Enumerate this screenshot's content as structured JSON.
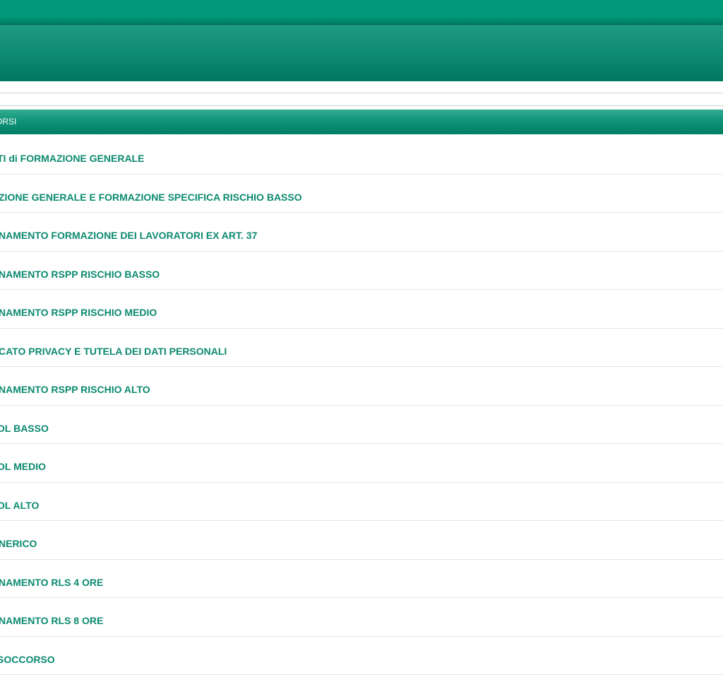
{
  "header": {
    "section_label": "ORSI"
  },
  "courses": [
    {
      "label": "TI di FORMAZIONE GENERALE",
      "cut": 7
    },
    {
      "label": "ZIONE GENERALE E FORMAZIONE SPECIFICA RISCHIO BASSO",
      "cut": 4
    },
    {
      "label": "NAMENTO FORMAZIONE DEI LAVORATORI EX ART. 37",
      "cut": 3
    },
    {
      "label": "NAMENTO RSPP RISCHIO BASSO",
      "cut": 3
    },
    {
      "label": "NAMENTO RSPP RISCHIO MEDIO",
      "cut": 3
    },
    {
      "label": "CATO PRIVACY E TUTELA DEI DATI PERSONALI",
      "cut": 3
    },
    {
      "label": "NAMENTO RSPP RISCHIO ALTO",
      "cut": 3
    },
    {
      "label": "OL BASSO",
      "cut": 6
    },
    {
      "label": "OL MEDIO",
      "cut": 6
    },
    {
      "label": "OL ALTO",
      "cut": 6
    },
    {
      "label": "NERICO",
      "cut": 3
    },
    {
      "label": "NAMENTO RLS 4 ORE",
      "cut": 3
    },
    {
      "label": "NAMENTO RLS 8 ORE",
      "cut": 3
    },
    {
      "label": "SOCCORSO",
      "cut": 5
    }
  ]
}
